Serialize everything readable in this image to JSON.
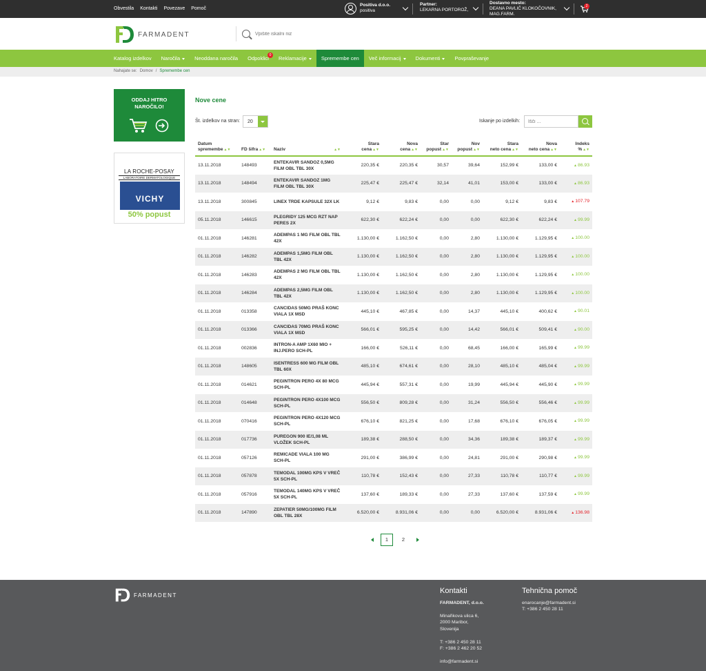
{
  "top": {
    "links": [
      "Obvestila",
      "Kontakti",
      "Povezave",
      "Pomoč"
    ],
    "company": "Positiva d.o.o.",
    "company_sub": "positiva",
    "partner_label": "Partner:",
    "partner_value": "LEKARNA PORTOROŽ,",
    "delivery_label": "Dostavno mesto:",
    "delivery_value1": "DEANA PAVLIČ KLOKOČOVNIK,",
    "delivery_value2": "MAG.FARM.",
    "cart_count": "2"
  },
  "header": {
    "logo_text": "FARMADENT",
    "search_placeholder": "Vpišite iskalni niz"
  },
  "nav": {
    "items": [
      {
        "label": "Katalog izdelkov",
        "caret": false
      },
      {
        "label": "Naročila",
        "caret": true
      },
      {
        "label": "Neoddana naročila",
        "caret": false
      },
      {
        "label": "Odpoklici",
        "caret": false,
        "badge": "0"
      },
      {
        "label": "Reklamacije",
        "caret": true
      },
      {
        "label": "Spremembe cen",
        "caret": false,
        "active": true
      },
      {
        "label": "Več informacij",
        "caret": true
      },
      {
        "label": "Dokumenti",
        "caret": true
      },
      {
        "label": "Povpraševanje",
        "caret": false
      }
    ]
  },
  "breadcrumb": {
    "prefix": "Nahajate se:",
    "home": "Domov",
    "sep": "/",
    "current": "Spremembe cen"
  },
  "sidebar": {
    "promo_line1": "ODDAJ HITRO",
    "promo_line2": "NAROČILO!",
    "banner_brand": "LA ROCHE-POSAY",
    "banner_sub": "LABORATOIRE DERMATOLOGIQUE",
    "banner_vichy": "VICHY",
    "banner_offer": "50% popust"
  },
  "main": {
    "title": "Nove cene",
    "per_page_label": "Št. izdelkov na stran:",
    "per_page_value": "20",
    "search_label": "Iskanje po izdelkih:",
    "search_placeholder": "Išči ..."
  },
  "colors": {
    "accent": "#8dc63f",
    "dark_green": "#1e8a3a",
    "up": "#8dc63f",
    "down": "#e3232b"
  },
  "table": {
    "headers": [
      {
        "l1": "Datum",
        "l2": "spremembe"
      },
      {
        "l1": "",
        "l2": "FD šifra"
      },
      {
        "l1": "",
        "l2": "Naziv"
      },
      {
        "l1": "Stara",
        "l2": "cena"
      },
      {
        "l1": "Nova",
        "l2": "cena"
      },
      {
        "l1": "Star",
        "l2": "popust"
      },
      {
        "l1": "Nov",
        "l2": "popust"
      },
      {
        "l1": "Stara",
        "l2": "neto cena"
      },
      {
        "l1": "Nova",
        "l2": "neto cena"
      },
      {
        "l1": "",
        "l2": "Indeks %"
      }
    ],
    "rows": [
      {
        "date": "13.11.2018",
        "code": "148493",
        "name": "ENTEKAVIR SANDOZ 0,5MG FILM OBL TBL 30X",
        "old": "220,35 €",
        "new": "220,35 €",
        "oldd": "30,57",
        "newd": "39,64",
        "oldn": "152,99 €",
        "newn": "133,00 €",
        "idx": "86.93",
        "dir": "up"
      },
      {
        "date": "13.11.2018",
        "code": "148494",
        "name": "ENTEKAVIR SANDOZ 1MG FILM OBL TBL 30X",
        "old": "225,47 €",
        "new": "225,47 €",
        "oldd": "32,14",
        "newd": "41,01",
        "oldn": "153,00 €",
        "newn": "133,00 €",
        "idx": "86.93",
        "dir": "up"
      },
      {
        "date": "13.11.2018",
        "code": "300845",
        "name": "LINEX TRDE KAPSULE 32X LK",
        "old": "9,12 €",
        "new": "9,83 €",
        "oldd": "0,00",
        "newd": "0,00",
        "oldn": "9,12 €",
        "newn": "9,83 €",
        "idx": "107.79",
        "dir": "down"
      },
      {
        "date": "05.11.2018",
        "code": "146615",
        "name": "PLEGRIDY 125 MCG RZT NAP PERES 2X",
        "old": "622,30 €",
        "new": "622,24 €",
        "oldd": "0,00",
        "newd": "0,00",
        "oldn": "622,30 €",
        "newn": "622,24 €",
        "idx": "99.99",
        "dir": "up"
      },
      {
        "date": "01.11.2018",
        "code": "146281",
        "name": "ADEMPAS 1 MG FILM OBL TBL 42X",
        "old": "1.130,00 €",
        "new": "1.162,50 €",
        "oldd": "0,00",
        "newd": "2,80",
        "oldn": "1.130,00 €",
        "newn": "1.129,95 €",
        "idx": "100.00",
        "dir": "up"
      },
      {
        "date": "01.11.2018",
        "code": "146282",
        "name": "ADEMPAS 1,5MG FILM OBL TBL 42X",
        "old": "1.130,00 €",
        "new": "1.162,50 €",
        "oldd": "0,00",
        "newd": "2,80",
        "oldn": "1.130,00 €",
        "newn": "1.129,95 €",
        "idx": "100.00",
        "dir": "up"
      },
      {
        "date": "01.11.2018",
        "code": "146283",
        "name": "ADEMPAS 2 MG FILM OBL TBL 42X",
        "old": "1.130,00 €",
        "new": "1.162,50 €",
        "oldd": "0,00",
        "newd": "2,80",
        "oldn": "1.130,00 €",
        "newn": "1.129,95 €",
        "idx": "100.00",
        "dir": "up"
      },
      {
        "date": "01.11.2018",
        "code": "146284",
        "name": "ADEMPAS 2,5MG FILM OBL TBL 42X",
        "old": "1.130,00 €",
        "new": "1.162,50 €",
        "oldd": "0,00",
        "newd": "2,80",
        "oldn": "1.130,00 €",
        "newn": "1.129,95 €",
        "idx": "100.00",
        "dir": "up"
      },
      {
        "date": "01.11.2018",
        "code": "013358",
        "name": "CANCIDAS 50MG PRAŠ KONC VIALA 1X MSD",
        "old": "445,10 €",
        "new": "467,85 €",
        "oldd": "0,00",
        "newd": "14,37",
        "oldn": "445,10 €",
        "newn": "400,62 €",
        "idx": "90.01",
        "dir": "up"
      },
      {
        "date": "01.11.2018",
        "code": "013366",
        "name": "CANCIDAS 70MG PRAŠ KONC VIALA 1X MSD",
        "old": "566,01 €",
        "new": "595,25 €",
        "oldd": "0,00",
        "newd": "14,42",
        "oldn": "566,01 €",
        "newn": "509,41 €",
        "idx": "90.00",
        "dir": "up"
      },
      {
        "date": "01.11.2018",
        "code": "002836",
        "name": "INTRON-A AMP 1X60 MIO + INJ.PERO SCH-PL",
        "old": "166,00 €",
        "new": "526,11 €",
        "oldd": "0,00",
        "newd": "68,45",
        "oldn": "166,00 €",
        "newn": "165,99 €",
        "idx": "99.99",
        "dir": "up"
      },
      {
        "date": "01.11.2018",
        "code": "148605",
        "name": "ISENTRESS 600 MG FILM OBL TBL 60X",
        "old": "485,10 €",
        "new": "674,61 €",
        "oldd": "0,00",
        "newd": "28,10",
        "oldn": "485,10 €",
        "newn": "485,04 €",
        "idx": "99.99",
        "dir": "up"
      },
      {
        "date": "01.11.2018",
        "code": "014621",
        "name": "PEGINTRON PERO 4X 80 MCG SCH-PL",
        "old": "445,94 €",
        "new": "557,31 €",
        "oldd": "0,00",
        "newd": "19,99",
        "oldn": "445,94 €",
        "newn": "445,90 €",
        "idx": "99.99",
        "dir": "up"
      },
      {
        "date": "01.11.2018",
        "code": "014648",
        "name": "PEGINTRON PERO 4X100 MCG SCH-PL",
        "old": "556,50 €",
        "new": "809,28 €",
        "oldd": "0,00",
        "newd": "31,24",
        "oldn": "556,50 €",
        "newn": "556,46 €",
        "idx": "99.99",
        "dir": "up"
      },
      {
        "date": "01.11.2018",
        "code": "070416",
        "name": "PEGINTRON PERO 4X120 MCG SCH-PL",
        "old": "676,10 €",
        "new": "821,25 €",
        "oldd": "0,00",
        "newd": "17,68",
        "oldn": "676,10 €",
        "newn": "676,05 €",
        "idx": "99.99",
        "dir": "up"
      },
      {
        "date": "01.11.2018",
        "code": "017736",
        "name": "PUREGON 900 IE/1,08 ML VLOŽEK SCH-PL",
        "old": "189,38 €",
        "new": "288,50 €",
        "oldd": "0,00",
        "newd": "34,36",
        "oldn": "189,38 €",
        "newn": "189,37 €",
        "idx": "99.99",
        "dir": "up"
      },
      {
        "date": "01.11.2018",
        "code": "057126",
        "name": "REMICADE VIALA 100 MG SCH-PL",
        "old": "291,00 €",
        "new": "386,99 €",
        "oldd": "0,00",
        "newd": "24,81",
        "oldn": "291,00 €",
        "newn": "290,98 €",
        "idx": "99.99",
        "dir": "up"
      },
      {
        "date": "01.11.2018",
        "code": "057878",
        "name": "TEMODAL 100MG KPS V VREČ 5X SCH-PL",
        "old": "110,78 €",
        "new": "152,43 €",
        "oldd": "0,00",
        "newd": "27,33",
        "oldn": "110,78 €",
        "newn": "110,77 €",
        "idx": "99.99",
        "dir": "up"
      },
      {
        "date": "01.11.2018",
        "code": "057916",
        "name": "TEMODAL 140MG KPS V VREČ 5X SCH-PL",
        "old": "137,60 €",
        "new": "189,33 €",
        "oldd": "0,00",
        "newd": "27,33",
        "oldn": "137,60 €",
        "newn": "137,59 €",
        "idx": "99.99",
        "dir": "up"
      },
      {
        "date": "01.11.2018",
        "code": "147890",
        "name": "ZEPATIER 50MG/100MG FILM OBL TBL 28X",
        "old": "6.520,00 €",
        "new": "8.931,06 €",
        "oldd": "0,00",
        "newd": "0,00",
        "oldn": "6.520,00 €",
        "newn": "8.931,06 €",
        "idx": "136.98",
        "dir": "down"
      }
    ]
  },
  "pagination": {
    "pages": [
      "1",
      "2"
    ],
    "current": "1"
  },
  "footer": {
    "logo_text": "FARMADENT",
    "contacts_title": "Kontakti",
    "company": "FARMADENT, d.o.o.",
    "address1": "Minařikova ulica 6,",
    "address2": "2000 Maribor,",
    "address3": "Slovenija",
    "tel": "T: +386 2 450 28 11",
    "fax": "F: +386 2 462 20 52",
    "email": "info@farmadent.si",
    "support_title": "Tehnična pomoč",
    "support_email": "enarocanje@farmadent.si",
    "support_tel": "T: +386 2 450 28 11"
  }
}
